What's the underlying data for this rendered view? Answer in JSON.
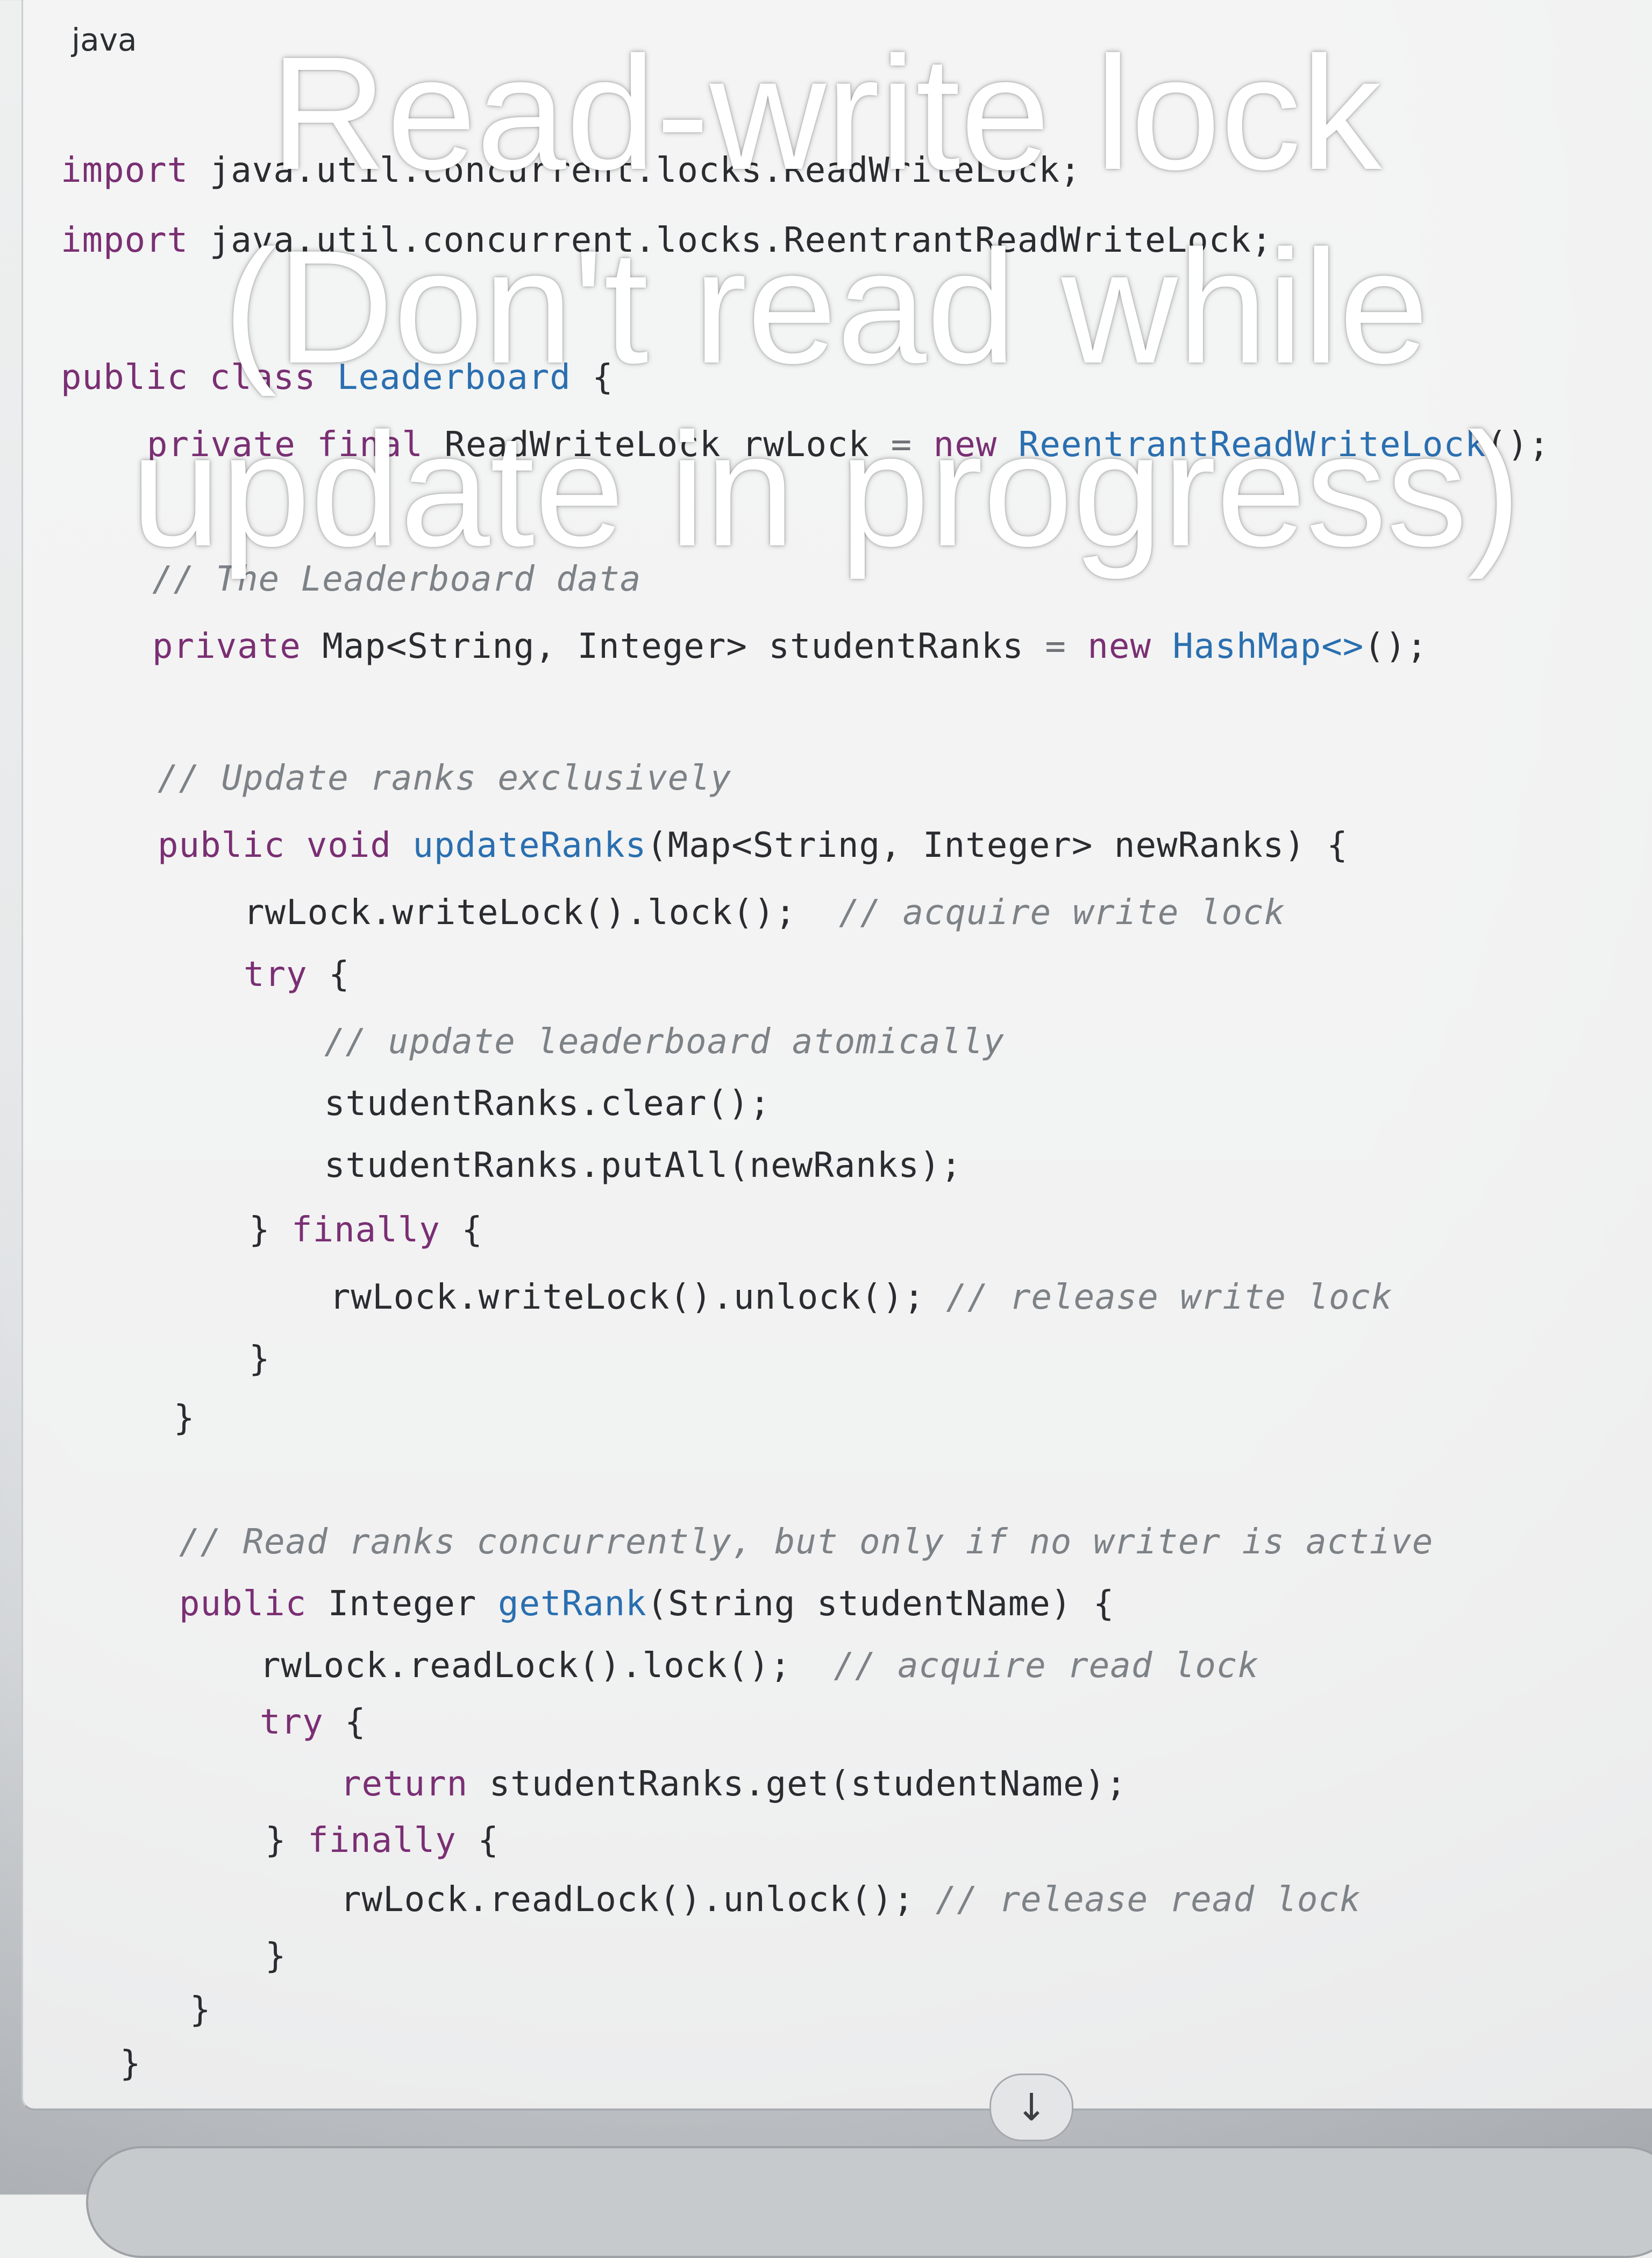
{
  "code_block": {
    "language": "java",
    "lines": [
      {
        "segments": [
          {
            "c": "kw",
            "t": "import "
          },
          {
            "c": "pl",
            "t": "java.util.concurrent.locks.ReadWriteLock;"
          }
        ]
      },
      {
        "segments": [
          {
            "c": "kw",
            "t": "import "
          },
          {
            "c": "pl",
            "t": "java.util.concurrent.locks.ReentrantReadWriteLock;"
          }
        ]
      },
      {
        "segments": [
          {
            "c": "kw",
            "t": "public class "
          },
          {
            "c": "fn",
            "t": "Leaderboard"
          },
          {
            "c": "pl",
            "t": " {"
          }
        ]
      },
      {
        "segments": [
          {
            "c": "kw",
            "t": "private final "
          },
          {
            "c": "ty",
            "t": "ReadWriteLock "
          },
          {
            "c": "pl",
            "t": "rwLock "
          },
          {
            "c": "op",
            "t": "= "
          },
          {
            "c": "kw",
            "t": "new "
          },
          {
            "c": "fn",
            "t": "ReentrantReadWriteLock"
          },
          {
            "c": "pl",
            "t": "();"
          }
        ]
      },
      {
        "segments": [
          {
            "c": "cm",
            "t": "// The Leaderboard data"
          }
        ]
      },
      {
        "segments": [
          {
            "c": "kw",
            "t": "private "
          },
          {
            "c": "ty",
            "t": "Map<String, Integer> "
          },
          {
            "c": "pl",
            "t": "studentRanks "
          },
          {
            "c": "op",
            "t": "= "
          },
          {
            "c": "kw",
            "t": "new "
          },
          {
            "c": "fn",
            "t": "HashMap<>"
          },
          {
            "c": "pl",
            "t": "();"
          }
        ]
      },
      {
        "segments": [
          {
            "c": "cm",
            "t": "// Update ranks exclusively"
          }
        ]
      },
      {
        "segments": [
          {
            "c": "kw",
            "t": "public void "
          },
          {
            "c": "fn",
            "t": "updateRanks"
          },
          {
            "c": "pl",
            "t": "(Map<String, Integer> newRanks) {"
          }
        ]
      },
      {
        "segments": [
          {
            "c": "pl",
            "t": "rwLock.writeLock().lock();  "
          },
          {
            "c": "cm",
            "t": "// acquire write lock"
          }
        ]
      },
      {
        "segments": [
          {
            "c": "kw",
            "t": "try "
          },
          {
            "c": "pl",
            "t": "{"
          }
        ]
      },
      {
        "segments": [
          {
            "c": "cm",
            "t": "// update leaderboard atomically"
          }
        ]
      },
      {
        "segments": [
          {
            "c": "pl",
            "t": "studentRanks.clear();"
          }
        ]
      },
      {
        "segments": [
          {
            "c": "pl",
            "t": "studentRanks.putAll(newRanks);"
          }
        ]
      },
      {
        "segments": [
          {
            "c": "pl",
            "t": "} "
          },
          {
            "c": "kw",
            "t": "finally "
          },
          {
            "c": "pl",
            "t": "{"
          }
        ]
      },
      {
        "segments": [
          {
            "c": "pl",
            "t": "rwLock.writeLock().unlock(); "
          },
          {
            "c": "cm",
            "t": "// release write lock"
          }
        ]
      },
      {
        "segments": [
          {
            "c": "pl",
            "t": "}"
          }
        ]
      },
      {
        "segments": [
          {
            "c": "pl",
            "t": "}"
          }
        ]
      },
      {
        "segments": [
          {
            "c": "cm",
            "t": "// Read ranks concurrently, but only if no writer is active"
          }
        ]
      },
      {
        "segments": [
          {
            "c": "kw",
            "t": "public "
          },
          {
            "c": "ty",
            "t": "Integer "
          },
          {
            "c": "fn",
            "t": "getRank"
          },
          {
            "c": "pl",
            "t": "(String studentName) {"
          }
        ]
      },
      {
        "segments": [
          {
            "c": "pl",
            "t": "rwLock.readLock().lock();  "
          },
          {
            "c": "cm",
            "t": "// acquire read lock"
          }
        ]
      },
      {
        "segments": [
          {
            "c": "kw",
            "t": "try "
          },
          {
            "c": "pl",
            "t": "{"
          }
        ]
      },
      {
        "segments": [
          {
            "c": "kw",
            "t": "return "
          },
          {
            "c": "pl",
            "t": "studentRanks.get(studentName);"
          }
        ]
      },
      {
        "segments": [
          {
            "c": "pl",
            "t": "} "
          },
          {
            "c": "kw",
            "t": "finally "
          },
          {
            "c": "pl",
            "t": "{"
          }
        ]
      },
      {
        "segments": [
          {
            "c": "pl",
            "t": "rwLock.readLock().unlock(); "
          },
          {
            "c": "cm",
            "t": "// release read lock"
          }
        ]
      },
      {
        "segments": [
          {
            "c": "pl",
            "t": "}"
          }
        ]
      },
      {
        "segments": [
          {
            "c": "pl",
            "t": "}"
          }
        ]
      },
      {
        "segments": [
          {
            "c": "pl",
            "t": "}"
          }
        ]
      }
    ]
  },
  "overlay_caption": {
    "line1": "Read-write lock",
    "line2": "(Don't read while",
    "line3": "update in progress)"
  },
  "controls": {
    "scroll_down_icon": "arrow-down-icon",
    "scroll_down_glyph": "↓"
  },
  "colors": {
    "keyword": "#7a2f73",
    "function": "#2a6fb0",
    "comment": "#7d8287",
    "caption": "#ffffff"
  }
}
